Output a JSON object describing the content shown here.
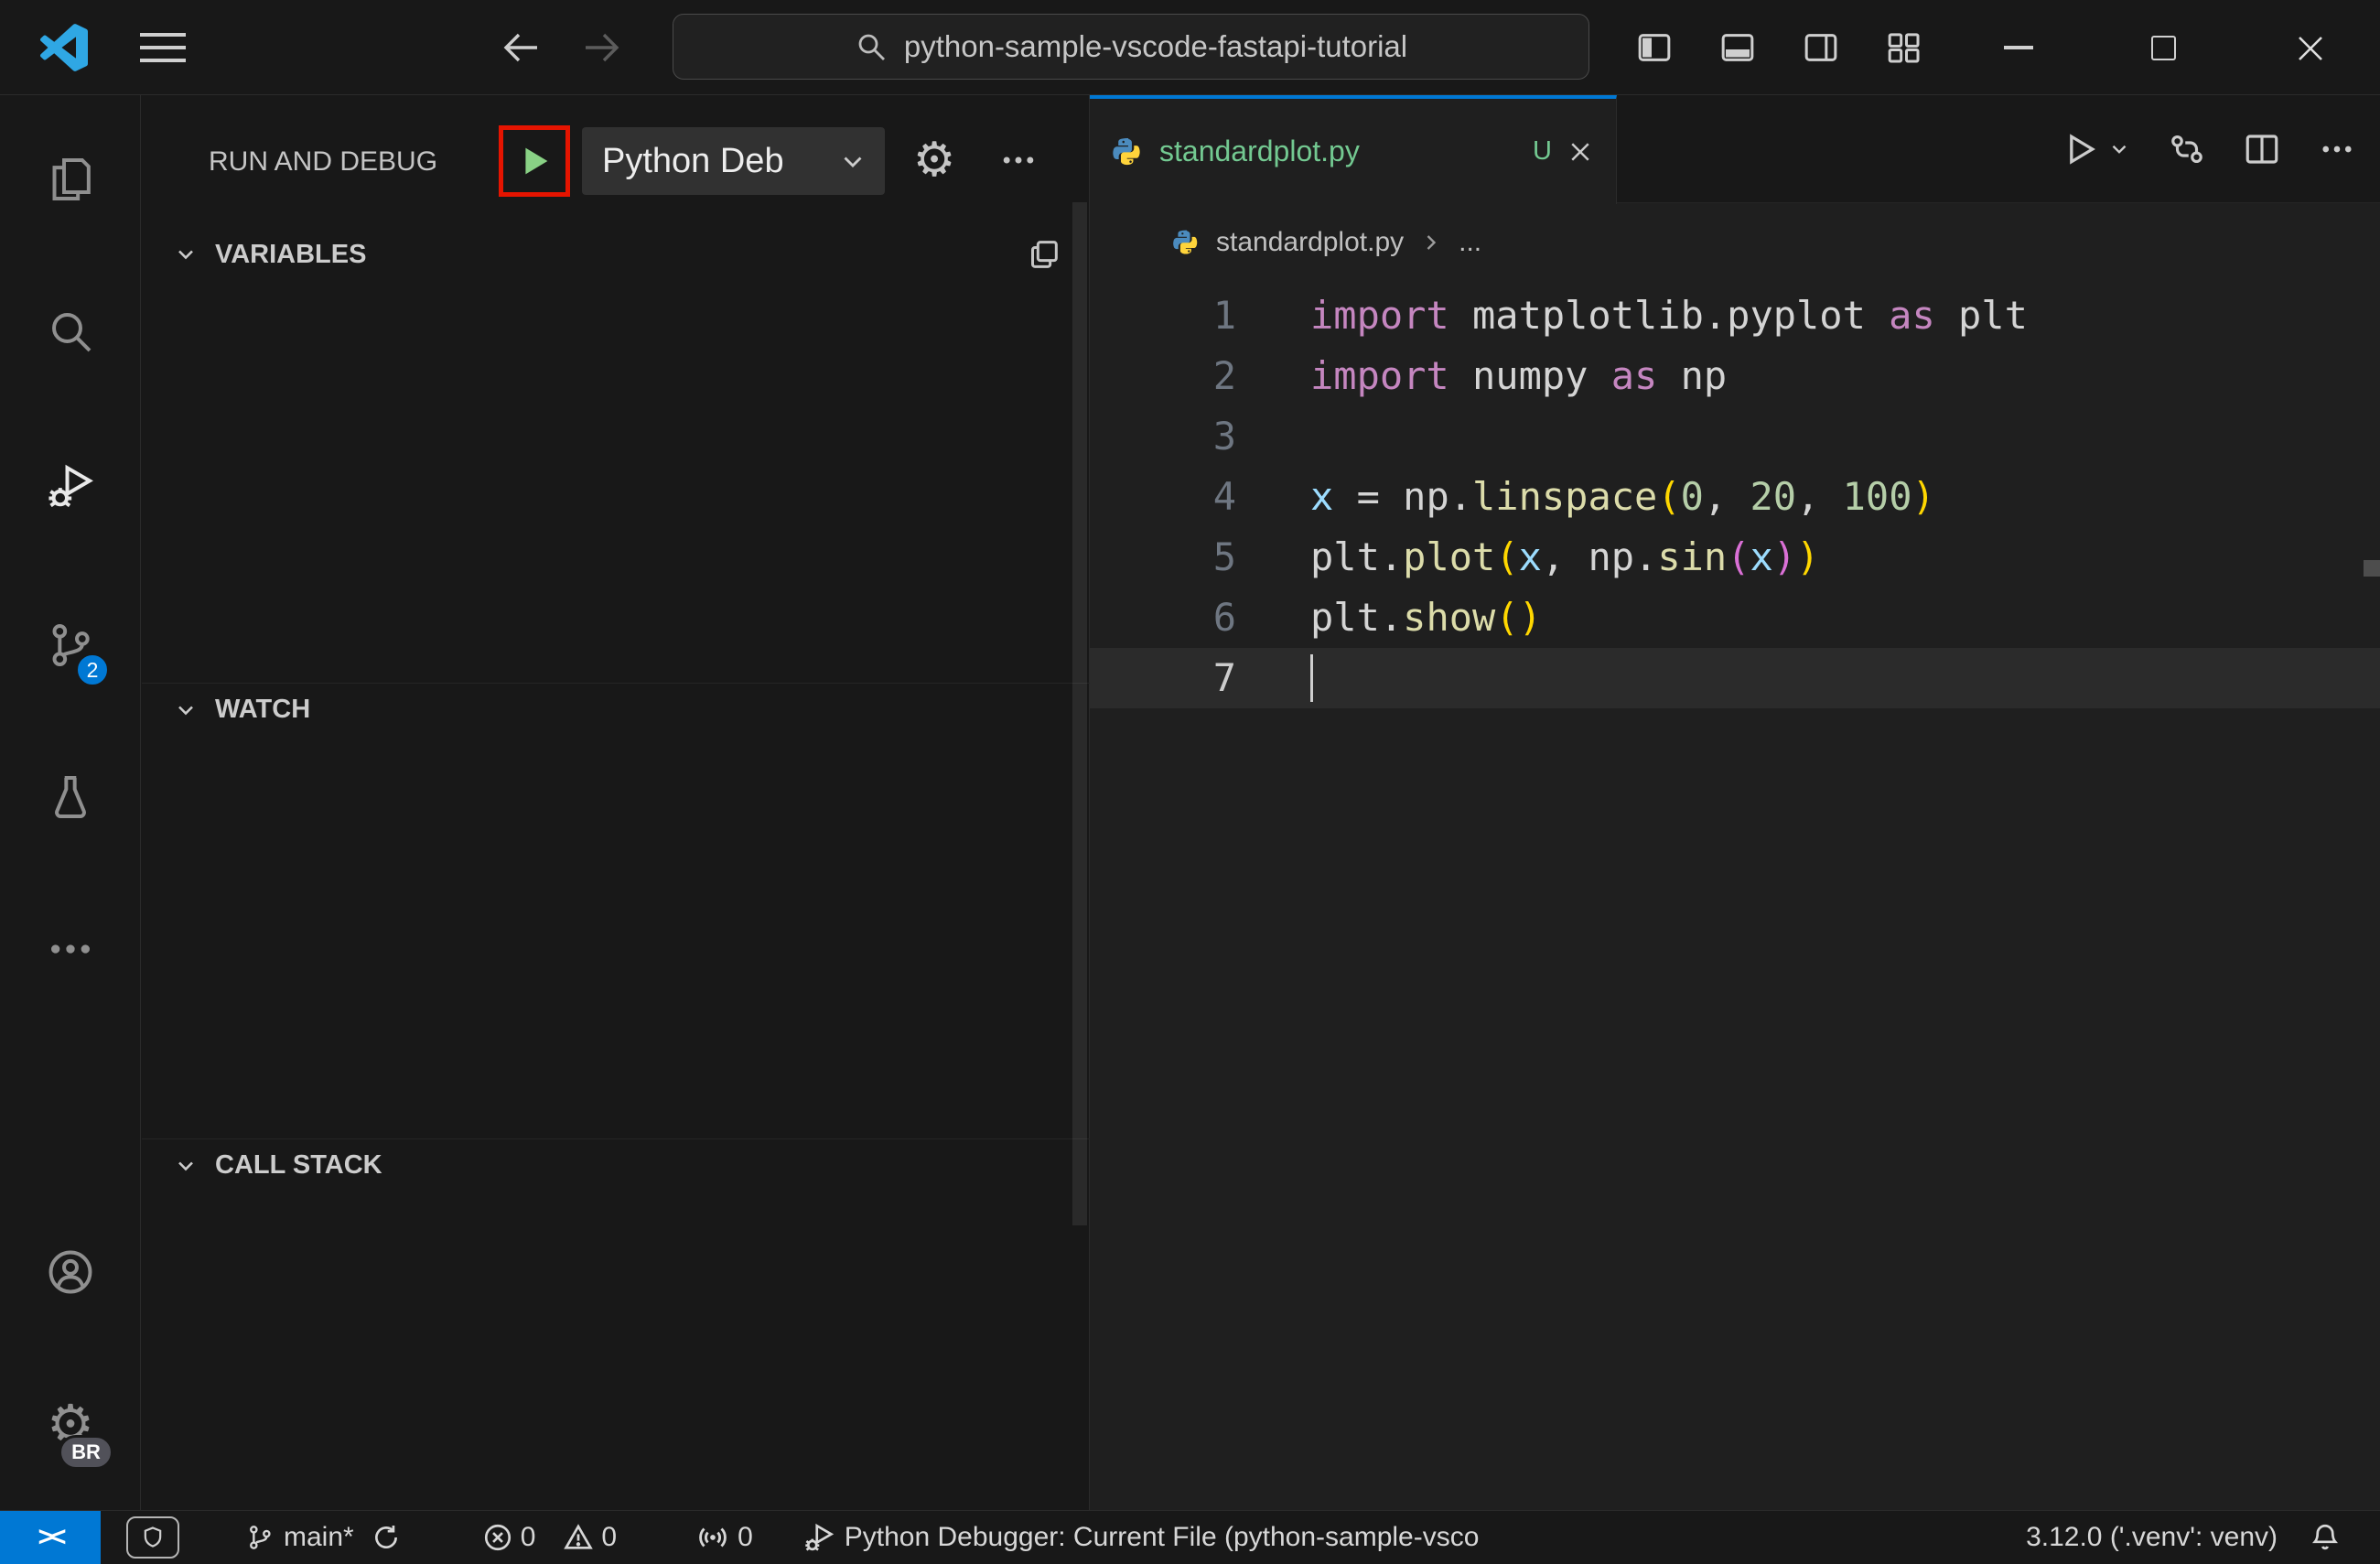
{
  "colors": {
    "accent_blue": "#0078d4",
    "git_untracked_green": "#73C991",
    "annotation_red": "#e51400",
    "debug_start_green": "#89D185",
    "editor_background": "#1f1f1f",
    "chrome_background": "#181818"
  },
  "titlebar": {
    "search_value": "python-sample-vscode-fastapi-tutorial"
  },
  "activity_bar": {
    "scm_badge": "2",
    "profile_badge": "BR"
  },
  "sidebar": {
    "title": "RUN AND DEBUG",
    "config_dropdown": "Python Deb",
    "sections": {
      "variables": "VARIABLES",
      "watch": "WATCH",
      "call_stack": "CALL STACK"
    }
  },
  "editor": {
    "tab": {
      "label": "standardplot.py",
      "git_status": "U"
    },
    "breadcrumb": {
      "file": "standardplot.py",
      "ellipsis": "..."
    },
    "code": {
      "token_colors": {
        "keyword": "#C586C0",
        "plain": "#D4D4D4",
        "variable": "#9CDCFE",
        "function": "#DCDCAA",
        "number": "#B5CEA8",
        "bracket1": "#FFD700",
        "bracket2": "#DA70D6"
      },
      "lines": [
        {
          "tokens": [
            {
              "t": "import",
              "c": "keyword"
            },
            {
              "t": " matplotlib.pyplot ",
              "c": "plain"
            },
            {
              "t": "as",
              "c": "keyword"
            },
            {
              "t": " plt",
              "c": "plain"
            }
          ]
        },
        {
          "tokens": [
            {
              "t": "import",
              "c": "keyword"
            },
            {
              "t": " numpy ",
              "c": "plain"
            },
            {
              "t": "as",
              "c": "keyword"
            },
            {
              "t": " np",
              "c": "plain"
            }
          ]
        },
        {
          "tokens": []
        },
        {
          "tokens": [
            {
              "t": "x",
              "c": "variable"
            },
            {
              "t": " = np.",
              "c": "plain"
            },
            {
              "t": "linspace",
              "c": "function"
            },
            {
              "t": "(",
              "c": "bracket1"
            },
            {
              "t": "0",
              "c": "number"
            },
            {
              "t": ", ",
              "c": "plain"
            },
            {
              "t": "20",
              "c": "number"
            },
            {
              "t": ", ",
              "c": "plain"
            },
            {
              "t": "100",
              "c": "number"
            },
            {
              "t": ")",
              "c": "bracket1"
            }
          ]
        },
        {
          "tokens": [
            {
              "t": "plt.",
              "c": "plain"
            },
            {
              "t": "plot",
              "c": "function"
            },
            {
              "t": "(",
              "c": "bracket1"
            },
            {
              "t": "x",
              "c": "variable"
            },
            {
              "t": ", np.",
              "c": "plain"
            },
            {
              "t": "sin",
              "c": "function"
            },
            {
              "t": "(",
              "c": "bracket2"
            },
            {
              "t": "x",
              "c": "variable"
            },
            {
              "t": ")",
              "c": "bracket2"
            },
            {
              "t": ")",
              "c": "bracket1"
            }
          ]
        },
        {
          "tokens": [
            {
              "t": "plt.",
              "c": "plain"
            },
            {
              "t": "show",
              "c": "function"
            },
            {
              "t": "(",
              "c": "bracket1"
            },
            {
              "t": ")",
              "c": "bracket1"
            }
          ]
        },
        {
          "tokens": [],
          "current": true,
          "cursor": true
        }
      ]
    }
  },
  "status_bar": {
    "remote_glyph": "><",
    "branch": "main*",
    "errors": "0",
    "warnings": "0",
    "ports": "0",
    "debug_status": "Python Debugger: Current File (python-sample-vsco",
    "python_version": "3.12.0 ('.venv': venv)"
  }
}
